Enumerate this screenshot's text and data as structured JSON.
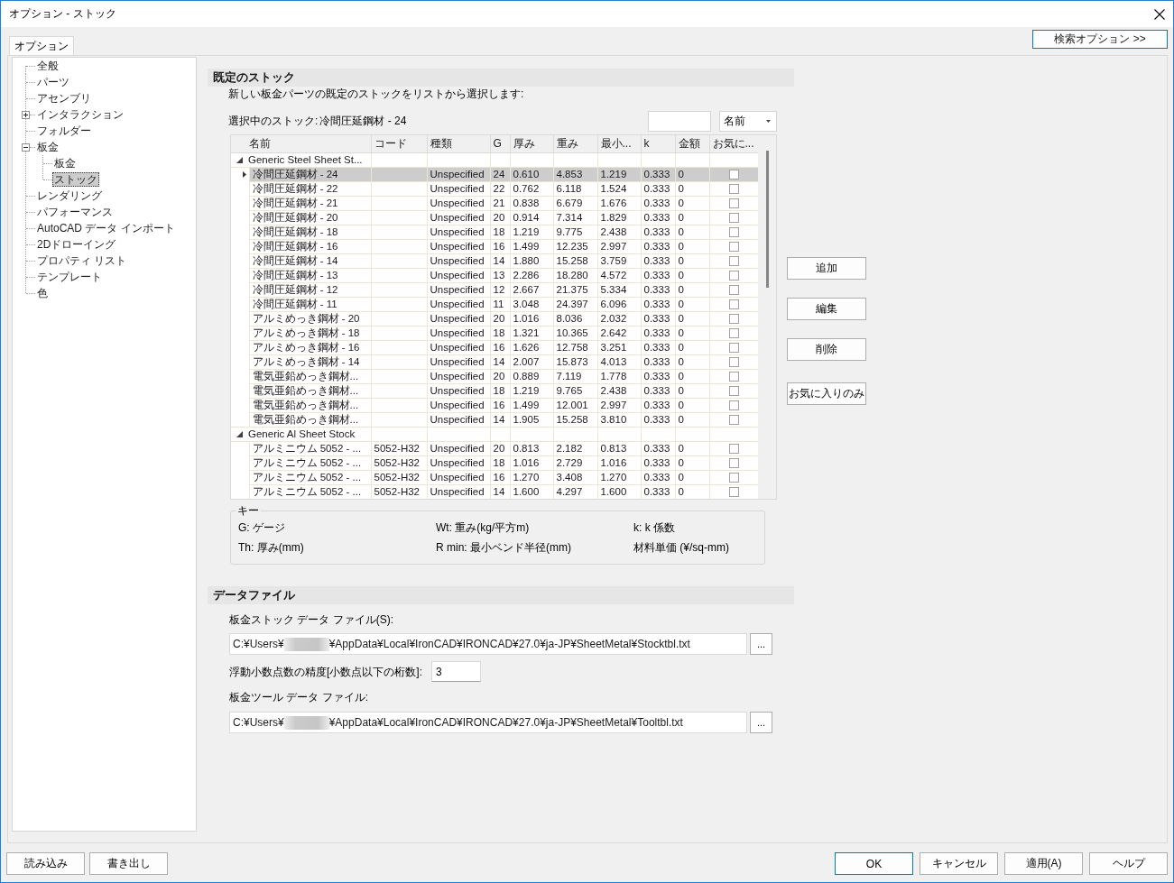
{
  "window": {
    "title": "オプション - ストック"
  },
  "tabs": [
    {
      "label": "オプション",
      "selected": true
    }
  ],
  "search_options": {
    "label": "検索オプション >>",
    "focused": true
  },
  "tree": {
    "items": [
      {
        "label": "全般",
        "kind": "leaf",
        "selected": false
      },
      {
        "label": "パーツ",
        "kind": "leaf",
        "selected": false
      },
      {
        "label": "アセンブリ",
        "kind": "leaf",
        "selected": false
      },
      {
        "label": "インタラクション",
        "kind": "branch",
        "expanded": false,
        "selected": false
      },
      {
        "label": "フォルダー",
        "kind": "leaf",
        "selected": false
      },
      {
        "label": "板金",
        "kind": "branch",
        "expanded": true,
        "selected": false,
        "children": [
          {
            "label": "板金",
            "kind": "leaf",
            "selected": false
          },
          {
            "label": "ストック",
            "kind": "leaf",
            "selected": true
          }
        ]
      },
      {
        "label": "レンダリング",
        "kind": "leaf",
        "selected": false
      },
      {
        "label": "パフォーマンス",
        "kind": "leaf",
        "selected": false
      },
      {
        "label": "AutoCAD データ インポート",
        "kind": "leaf",
        "selected": false
      },
      {
        "label": "2Dドローイング",
        "kind": "leaf",
        "selected": false
      },
      {
        "label": "プロパティ リスト",
        "kind": "leaf",
        "selected": false
      },
      {
        "label": "テンプレート",
        "kind": "leaf",
        "selected": false
      },
      {
        "label": "色",
        "kind": "leaf",
        "selected": false
      }
    ]
  },
  "default_stock": {
    "title": "既定のストック",
    "description": "新しい板金パーツの既定のストックをリストから選択します:",
    "current_label": "選択中のストック:",
    "current_value": "冷間圧延鋼材 - 24",
    "sort_dropdown": {
      "value": "名前"
    },
    "table": {
      "columns": [
        "名前",
        "コード",
        "種類",
        "G",
        "厚み",
        "重み",
        "最小...",
        "k",
        "金額",
        "お気に..."
      ],
      "groups": [
        {
          "name": "Generic Steel Sheet St...",
          "expanded": true,
          "rows": [
            {
              "name": "冷間圧延鋼材 - 24",
              "type": "Unspecified",
              "gauge": "24",
              "thickness": "0.610",
              "weight": "4.853",
              "min_radius": "1.219",
              "k": "0.333",
              "price": "0",
              "favorite": false,
              "selected": true
            },
            {
              "name": "冷間圧延鋼材 - 22",
              "type": "Unspecified",
              "gauge": "22",
              "thickness": "0.762",
              "weight": "6.118",
              "min_radius": "1.524",
              "k": "0.333",
              "price": "0",
              "favorite": false,
              "selected": false
            },
            {
              "name": "冷間圧延鋼材 - 21",
              "type": "Unspecified",
              "gauge": "21",
              "thickness": "0.838",
              "weight": "6.679",
              "min_radius": "1.676",
              "k": "0.333",
              "price": "0",
              "favorite": false,
              "selected": false
            },
            {
              "name": "冷間圧延鋼材 - 20",
              "type": "Unspecified",
              "gauge": "20",
              "thickness": "0.914",
              "weight": "7.314",
              "min_radius": "1.829",
              "k": "0.333",
              "price": "0",
              "favorite": false,
              "selected": false
            },
            {
              "name": "冷間圧延鋼材 - 18",
              "type": "Unspecified",
              "gauge": "18",
              "thickness": "1.219",
              "weight": "9.775",
              "min_radius": "2.438",
              "k": "0.333",
              "price": "0",
              "favorite": false,
              "selected": false
            },
            {
              "name": "冷間圧延鋼材 - 16",
              "type": "Unspecified",
              "gauge": "16",
              "thickness": "1.499",
              "weight": "12.235",
              "min_radius": "2.997",
              "k": "0.333",
              "price": "0",
              "favorite": false,
              "selected": false
            },
            {
              "name": "冷間圧延鋼材 - 14",
              "type": "Unspecified",
              "gauge": "14",
              "thickness": "1.880",
              "weight": "15.258",
              "min_radius": "3.759",
              "k": "0.333",
              "price": "0",
              "favorite": false,
              "selected": false
            },
            {
              "name": "冷間圧延鋼材 - 13",
              "type": "Unspecified",
              "gauge": "13",
              "thickness": "2.286",
              "weight": "18.280",
              "min_radius": "4.572",
              "k": "0.333",
              "price": "0",
              "favorite": false,
              "selected": false
            },
            {
              "name": "冷間圧延鋼材 - 12",
              "type": "Unspecified",
              "gauge": "12",
              "thickness": "2.667",
              "weight": "21.375",
              "min_radius": "5.334",
              "k": "0.333",
              "price": "0",
              "favorite": false,
              "selected": false
            },
            {
              "name": "冷間圧延鋼材 - 11",
              "type": "Unspecified",
              "gauge": "11",
              "thickness": "3.048",
              "weight": "24.397",
              "min_radius": "6.096",
              "k": "0.333",
              "price": "0",
              "favorite": false,
              "selected": false
            },
            {
              "name": "アルミめっき鋼材 - 20",
              "type": "Unspecified",
              "gauge": "20",
              "thickness": "1.016",
              "weight": "8.036",
              "min_radius": "2.032",
              "k": "0.333",
              "price": "0",
              "favorite": false,
              "selected": false
            },
            {
              "name": "アルミめっき鋼材 - 18",
              "type": "Unspecified",
              "gauge": "18",
              "thickness": "1.321",
              "weight": "10.365",
              "min_radius": "2.642",
              "k": "0.333",
              "price": "0",
              "favorite": false,
              "selected": false
            },
            {
              "name": "アルミめっき鋼材 - 16",
              "type": "Unspecified",
              "gauge": "16",
              "thickness": "1.626",
              "weight": "12.758",
              "min_radius": "3.251",
              "k": "0.333",
              "price": "0",
              "favorite": false,
              "selected": false
            },
            {
              "name": "アルミめっき鋼材 - 14",
              "type": "Unspecified",
              "gauge": "14",
              "thickness": "2.007",
              "weight": "15.873",
              "min_radius": "4.013",
              "k": "0.333",
              "price": "0",
              "favorite": false,
              "selected": false
            },
            {
              "name": "電気亜鉛めっき鋼材...",
              "type": "Unspecified",
              "gauge": "20",
              "thickness": "0.889",
              "weight": "7.119",
              "min_radius": "1.778",
              "k": "0.333",
              "price": "0",
              "favorite": false,
              "selected": false
            },
            {
              "name": "電気亜鉛めっき鋼材...",
              "type": "Unspecified",
              "gauge": "18",
              "thickness": "1.219",
              "weight": "9.765",
              "min_radius": "2.438",
              "k": "0.333",
              "price": "0",
              "favorite": false,
              "selected": false
            },
            {
              "name": "電気亜鉛めっき鋼材...",
              "type": "Unspecified",
              "gauge": "16",
              "thickness": "1.499",
              "weight": "12.001",
              "min_radius": "2.997",
              "k": "0.333",
              "price": "0",
              "favorite": false,
              "selected": false
            },
            {
              "name": "電気亜鉛めっき鋼材...",
              "type": "Unspecified",
              "gauge": "14",
              "thickness": "1.905",
              "weight": "15.258",
              "min_radius": "3.810",
              "k": "0.333",
              "price": "0",
              "favorite": false,
              "selected": false
            }
          ]
        },
        {
          "name": "Generic Al Sheet Stock",
          "expanded": true,
          "rows": [
            {
              "name": "アルミニウム 5052 - ...",
              "code": "5052-H32",
              "type": "Unspecified",
              "gauge": "20",
              "thickness": "0.813",
              "weight": "2.182",
              "min_radius": "0.813",
              "k": "0.333",
              "price": "0",
              "favorite": false,
              "selected": false
            },
            {
              "name": "アルミニウム 5052 - ...",
              "code": "5052-H32",
              "type": "Unspecified",
              "gauge": "18",
              "thickness": "1.016",
              "weight": "2.729",
              "min_radius": "1.016",
              "k": "0.333",
              "price": "0",
              "favorite": false,
              "selected": false
            },
            {
              "name": "アルミニウム 5052 - ...",
              "code": "5052-H32",
              "type": "Unspecified",
              "gauge": "16",
              "thickness": "1.270",
              "weight": "3.408",
              "min_radius": "1.270",
              "k": "0.333",
              "price": "0",
              "favorite": false,
              "selected": false
            },
            {
              "name": "アルミニウム 5052 - ...",
              "code": "5052-H32",
              "type": "Unspecified",
              "gauge": "14",
              "thickness": "1.600",
              "weight": "4.297",
              "min_radius": "1.600",
              "k": "0.333",
              "price": "0",
              "favorite": false,
              "selected": false
            }
          ]
        }
      ]
    },
    "buttons": [
      "追加",
      "編集",
      "削除",
      "お気に入りのみ"
    ],
    "key": {
      "title": "キー",
      "items": [
        "G: ゲージ",
        "Wt: 重み(kg/平方m)",
        "k: k 係数",
        "Th: 厚み(mm)",
        "R min: 最小ベンド半径(mm)",
        "材料単価 (¥/sq-mm)"
      ]
    }
  },
  "data_files": {
    "title": "データファイル",
    "stock_file": {
      "label": "板金ストック データ ファイル(S):",
      "path_start": "C:¥Users¥",
      "path_end": "¥AppData¥Local¥IronCAD¥IRONCAD¥27.0¥ja-JP¥SheetMetal¥Stocktbl.txt",
      "browse": "..."
    },
    "precision": {
      "label": "浮動小数点数の精度[小数点以下の桁数]:",
      "value": "3"
    },
    "tool_file": {
      "label": "板金ツール データ ファイル:",
      "path_start": "C:¥Users¥",
      "path_end": "¥AppData¥Local¥IronCAD¥IRONCAD¥27.0¥ja-JP¥SheetMetal¥Tooltbl.txt",
      "browse": "..."
    }
  },
  "footer": {
    "left_buttons": [
      "読み込み",
      "書き出し"
    ],
    "right_buttons": [
      {
        "label": "OK",
        "default": true
      },
      {
        "label": "キャンセル",
        "default": false
      },
      {
        "label": "適用(A)",
        "default": false
      },
      {
        "label": "ヘルプ",
        "default": false
      }
    ]
  }
}
